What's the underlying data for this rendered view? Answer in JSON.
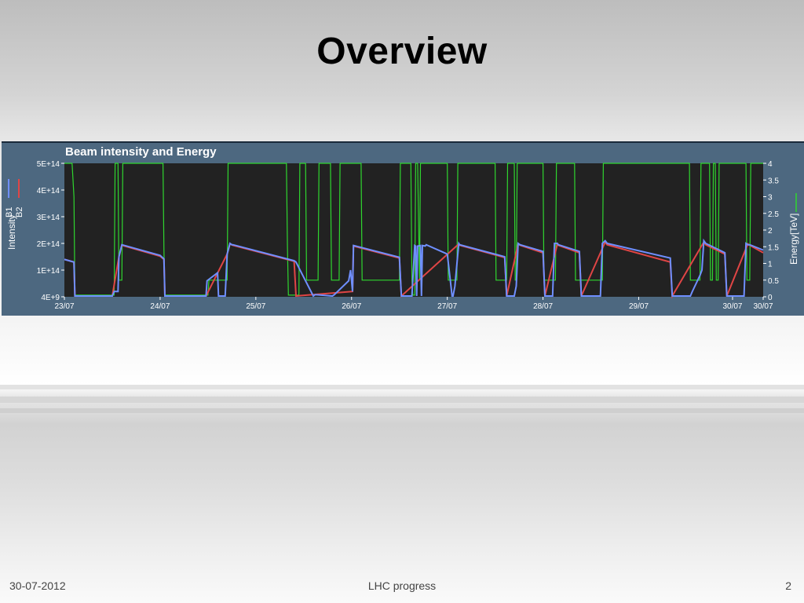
{
  "slide": {
    "title": "Overview",
    "footer_date": "30-07-2012",
    "footer_center": "LHC progress",
    "page_number": "2"
  },
  "chart_data": {
    "type": "line",
    "title": "Beam intensity and Energy",
    "ylabel_left": "Intensity",
    "ylabel_right": "Energy[TeV]",
    "legend": [
      "B1",
      "B2"
    ],
    "legend_placement": "left",
    "colors": {
      "B1": "#6f8fff",
      "B2": "#e04545",
      "Energy": "#2fd62f",
      "plot_bg": "#222222",
      "frame": "#4d6880"
    },
    "x_tick_labels": [
      "23/07",
      "24/07",
      "25/07",
      "26/07",
      "27/07",
      "28/07",
      "29/07",
      "30/07",
      "30/07"
    ],
    "x_tick_positions_days": [
      0,
      1,
      2,
      3,
      4,
      5,
      6,
      6.98,
      7.3
    ],
    "x_range_days": [
      0,
      7.3
    ],
    "y_left_ticks": [
      "5E+14",
      "4E+14",
      "3E+14",
      "2E+14",
      "1E+14",
      "4E+9"
    ],
    "y_left_range": [
      0,
      500000000000000.0
    ],
    "y_right_ticks": [
      "4",
      "3.5",
      "3",
      "2.5",
      "2",
      "1.5",
      "1",
      "0.5",
      "0"
    ],
    "y_right_range": [
      0,
      4
    ],
    "series": [
      {
        "name": "B1",
        "x": [
          0,
          0.1,
          0.11,
          0.5,
          0.52,
          0.56,
          0.57,
          0.6,
          1.0,
          1.04,
          1.05,
          1.48,
          1.49,
          1.6,
          1.61,
          1.68,
          1.7,
          1.73,
          1.75,
          1.76,
          2.4,
          2.42,
          2.6,
          2.62,
          2.8,
          2.82,
          2.97,
          2.99,
          3.01,
          3.02,
          3.5,
          3.52,
          3.63,
          3.66,
          3.67,
          3.68,
          3.69,
          3.72,
          3.73,
          3.74,
          3.77,
          3.78,
          4.0,
          4.05,
          4.06,
          4.08,
          4.09,
          4.12,
          4.13,
          4.6,
          4.62,
          4.7,
          4.72,
          4.74,
          4.76,
          5.0,
          5.02,
          5.1,
          5.12,
          5.15,
          5.16,
          5.38,
          5.4,
          5.6,
          5.62,
          5.65,
          5.67,
          6.33,
          6.35,
          6.54,
          6.56,
          6.64,
          6.66,
          6.68,
          6.7,
          6.9,
          6.92,
          7.1,
          7.12,
          7.14,
          7.16,
          7.3
        ],
        "values": [
          140000000000000.0,
          130000000000000.0,
          3000000000000.0,
          3000000000000.0,
          20000000000000.0,
          20000000000000.0,
          150000000000000.0,
          195000000000000.0,
          155000000000000.0,
          142000000000000.0,
          3000000000000.0,
          3000000000000.0,
          60000000000000.0,
          90000000000000.0,
          3000000000000.0,
          3000000000000.0,
          160000000000000.0,
          200000000000000.0,
          195000000000000.0,
          195000000000000.0,
          135000000000000.0,
          130000000000000.0,
          3000000000000.0,
          8000000000000.0,
          3000000000000.0,
          8000000000000.0,
          60000000000000.0,
          100000000000000.0,
          20000000000000.0,
          192000000000000.0,
          148000000000000.0,
          3000000000000.0,
          3000000000000.0,
          192000000000000.0,
          190000000000000.0,
          3000000000000.0,
          190000000000000.0,
          192000000000000.0,
          3000000000000.0,
          192000000000000.0,
          190000000000000.0,
          195000000000000.0,
          160000000000000.0,
          3000000000000.0,
          3000000000000.0,
          40000000000000.0,
          80000000000000.0,
          200000000000000.0,
          195000000000000.0,
          150000000000000.0,
          3000000000000.0,
          3000000000000.0,
          40000000000000.0,
          200000000000000.0,
          195000000000000.0,
          170000000000000.0,
          3000000000000.0,
          3000000000000.0,
          200000000000000.0,
          200000000000000.0,
          195000000000000.0,
          170000000000000.0,
          3000000000000.0,
          3000000000000.0,
          200000000000000.0,
          210000000000000.0,
          200000000000000.0,
          145000000000000.0,
          3000000000000.0,
          3000000000000.0,
          20000000000000.0,
          80000000000000.0,
          100000000000000.0,
          210000000000000.0,
          200000000000000.0,
          165000000000000.0,
          3000000000000.0,
          3000000000000.0,
          200000000000000.0,
          195000000000000.0,
          195000000000000.0,
          175000000000000.0
        ]
      },
      {
        "name": "B2",
        "x": [
          0,
          0.1,
          0.11,
          0.5,
          0.57,
          0.6,
          1.0,
          1.04,
          1.05,
          1.48,
          1.7,
          1.73,
          1.76,
          2.4,
          2.42,
          3.01,
          3.02,
          3.5,
          3.52,
          4.12,
          4.13,
          4.6,
          4.62,
          4.74,
          4.76,
          5.0,
          5.02,
          5.15,
          5.16,
          5.38,
          5.4,
          5.65,
          5.67,
          6.33,
          6.35,
          6.68,
          6.7,
          6.9,
          6.92,
          7.14,
          7.16,
          7.3
        ],
        "values": [
          140000000000000.0,
          130000000000000.0,
          3000000000000.0,
          3000000000000.0,
          150000000000000.0,
          193000000000000.0,
          152000000000000.0,
          140000000000000.0,
          3000000000000.0,
          3000000000000.0,
          160000000000000.0,
          198000000000000.0,
          193000000000000.0,
          133000000000000.0,
          3000000000000.0,
          20000000000000.0,
          190000000000000.0,
          145000000000000.0,
          3000000000000.0,
          198000000000000.0,
          193000000000000.0,
          147000000000000.0,
          3000000000000.0,
          198000000000000.0,
          193000000000000.0,
          165000000000000.0,
          3000000000000.0,
          198000000000000.0,
          193000000000000.0,
          165000000000000.0,
          3000000000000.0,
          205000000000000.0,
          195000000000000.0,
          130000000000000.0,
          3000000000000.0,
          205000000000000.0,
          195000000000000.0,
          160000000000000.0,
          3000000000000.0,
          198000000000000.0,
          193000000000000.0,
          165000000000000.0
        ]
      },
      {
        "name": "Energy",
        "axis": "right",
        "x": [
          0,
          0.08,
          0.1,
          0.11,
          0.52,
          0.53,
          0.56,
          0.57,
          0.6,
          0.61,
          1.03,
          1.04,
          1.05,
          1.5,
          1.51,
          1.7,
          1.71,
          2.32,
          2.33,
          2.34,
          2.45,
          2.46,
          2.52,
          2.53,
          2.65,
          2.66,
          2.78,
          2.79,
          2.87,
          2.88,
          3.1,
          3.11,
          3.5,
          3.51,
          3.62,
          3.63,
          3.64,
          3.66,
          3.67,
          3.69,
          3.71,
          3.72,
          3.77,
          4.0,
          4.01,
          4.05,
          4.1,
          4.11,
          4.5,
          4.51,
          4.62,
          4.63,
          4.7,
          4.71,
          4.72,
          4.73,
          5.0,
          5.01,
          5.13,
          5.14,
          5.33,
          5.34,
          5.62,
          5.63,
          6.53,
          6.54,
          6.64,
          6.65,
          6.74,
          6.75,
          6.77,
          6.78,
          6.8,
          6.81,
          6.83,
          6.84,
          7.12,
          7.13,
          7.16,
          7.17,
          7.3
        ],
        "values": [
          4,
          4,
          3,
          0.05,
          0.05,
          4,
          4,
          0.5,
          0.5,
          4,
          4,
          1.4,
          0.05,
          0.05,
          0.5,
          0.5,
          4,
          4,
          1.5,
          0.05,
          0.05,
          4,
          4,
          0.5,
          0.5,
          4,
          4,
          0.5,
          0.5,
          4,
          4,
          0.5,
          0.5,
          4,
          4,
          0.5,
          0.05,
          0.05,
          4,
          4,
          0.5,
          4,
          4,
          4,
          0.5,
          0.5,
          0.5,
          4,
          4,
          0.5,
          0.5,
          4,
          4,
          0.5,
          0.5,
          4,
          4,
          0.5,
          0.5,
          4,
          4,
          0.5,
          0.5,
          4,
          4,
          0.5,
          0.5,
          4,
          4,
          0.5,
          0.5,
          4,
          4,
          0.5,
          0.5,
          4,
          4,
          0.5,
          0.5,
          4,
          4
        ]
      }
    ]
  }
}
